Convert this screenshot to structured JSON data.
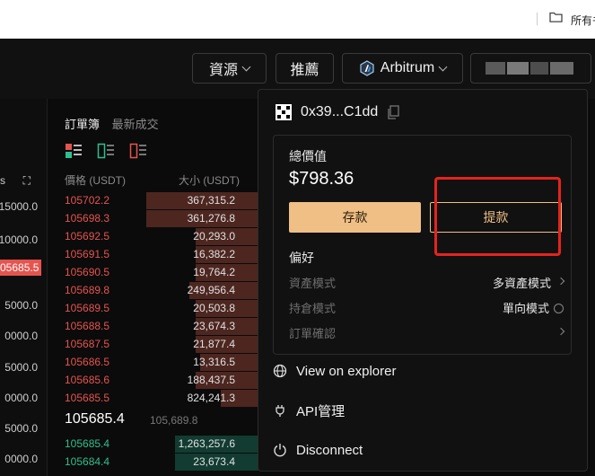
{
  "bookmarks": {
    "folder_label": "所有书"
  },
  "nav": {
    "assets_label": "資源",
    "recommend_label": "推薦",
    "network_label": "Arbitrum"
  },
  "left_column": {
    "rows": [
      "s",
      "15000.0",
      "10000.0",
      "05685.5",
      "5000.0",
      "0000.0",
      "5000.0",
      "0000.0",
      "5000.0",
      "0000.0",
      "5000.0"
    ]
  },
  "orderbook": {
    "tab_active": "訂單簿",
    "tab_inactive": "最新成交",
    "header_price": "價格 (USDT)",
    "header_size": "大小 (USDT)",
    "asks": [
      {
        "price": "105702.2",
        "size": "367,315.2",
        "depth": 0.54
      },
      {
        "price": "105698.3",
        "size": "361,276.8",
        "depth": 0.54
      },
      {
        "price": "105692.5",
        "size": "20,293.0",
        "depth": 0.3
      },
      {
        "price": "105691.5",
        "size": "16,382.2",
        "depth": 0.3
      },
      {
        "price": "105690.5",
        "size": "19,764.2",
        "depth": 0.3
      },
      {
        "price": "105689.8",
        "size": "249,956.4",
        "depth": 0.33
      },
      {
        "price": "105689.5",
        "size": "20,503.8",
        "depth": 0.3
      },
      {
        "price": "105688.5",
        "size": "23,674.3",
        "depth": 0.3
      },
      {
        "price": "105687.5",
        "size": "21,877.4",
        "depth": 0.3
      },
      {
        "price": "105686.5",
        "size": "13,316.5",
        "depth": 0.28
      },
      {
        "price": "105685.6",
        "size": "188,437.5",
        "depth": 0.3
      },
      {
        "price": "105685.5",
        "size": "824,241.3",
        "depth": 0.18
      }
    ],
    "mid_price": "105685.4",
    "mark_price": "105,689.8",
    "bids": [
      {
        "price": "105685.4",
        "size": "1,263,257.6",
        "depth": 0.4
      },
      {
        "price": "105684.4",
        "size": "23,673.4",
        "depth": 0.4
      }
    ]
  },
  "wallet": {
    "address": "0x39...C1dd",
    "total_label": "總價值",
    "total_value": "$798.36",
    "deposit_label": "存款",
    "withdraw_label": "提款",
    "preferences_title": "偏好",
    "prefs": [
      {
        "key": "資產模式",
        "value": "多資產模式",
        "icon": "chevron-right-icon"
      },
      {
        "key": "持倉模式",
        "value": "單向模式",
        "icon": "info-icon"
      },
      {
        "key": "訂單確認",
        "value": "",
        "icon": "chevron-right-icon"
      }
    ],
    "menu": {
      "explorer_label": "View on explorer",
      "api_label": "API管理",
      "disconnect_label": "Disconnect"
    }
  },
  "colors": {
    "accent": "#efbf85",
    "ask_red": "#e5544e",
    "bid_green": "#2fbf8e",
    "highlight_red": "#e5231d"
  }
}
